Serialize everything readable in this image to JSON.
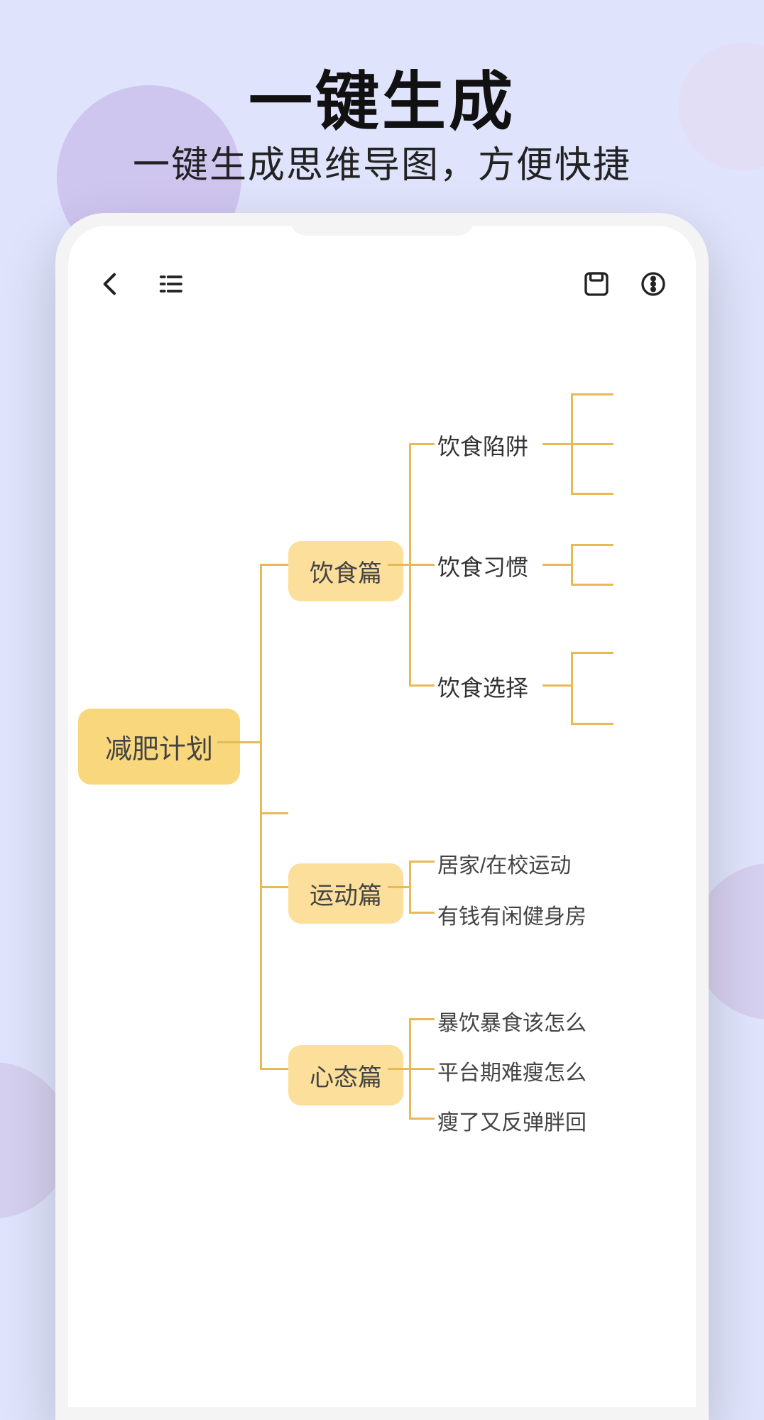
{
  "promo": {
    "headline": "一键生成",
    "subheadline": "一键生成思维导图，方便快捷"
  },
  "toolbar": {
    "back_icon": "back",
    "outline_icon": "outline",
    "save_icon": "save",
    "more_icon": "more"
  },
  "mindmap": {
    "root": "减肥计划",
    "branches": [
      {
        "label": "饮食篇",
        "children": [
          {
            "label": "饮食陷阱"
          },
          {
            "label": "饮食习惯"
          },
          {
            "label": "饮食选择"
          }
        ]
      },
      {
        "label": "运动篇",
        "children": [
          {
            "label": "居家/在校运动"
          },
          {
            "label": "有钱有闲健身房"
          }
        ]
      },
      {
        "label": "心态篇",
        "children": [
          {
            "label": "暴饮暴食该怎么"
          },
          {
            "label": "平台期难瘦怎么"
          },
          {
            "label": "瘦了又反弹胖回"
          }
        ]
      }
    ]
  },
  "colors": {
    "accent": "#f9d87d",
    "accent_light": "#fcdf9a",
    "connector": "#e8b957",
    "bg": "#dfe3fb"
  }
}
